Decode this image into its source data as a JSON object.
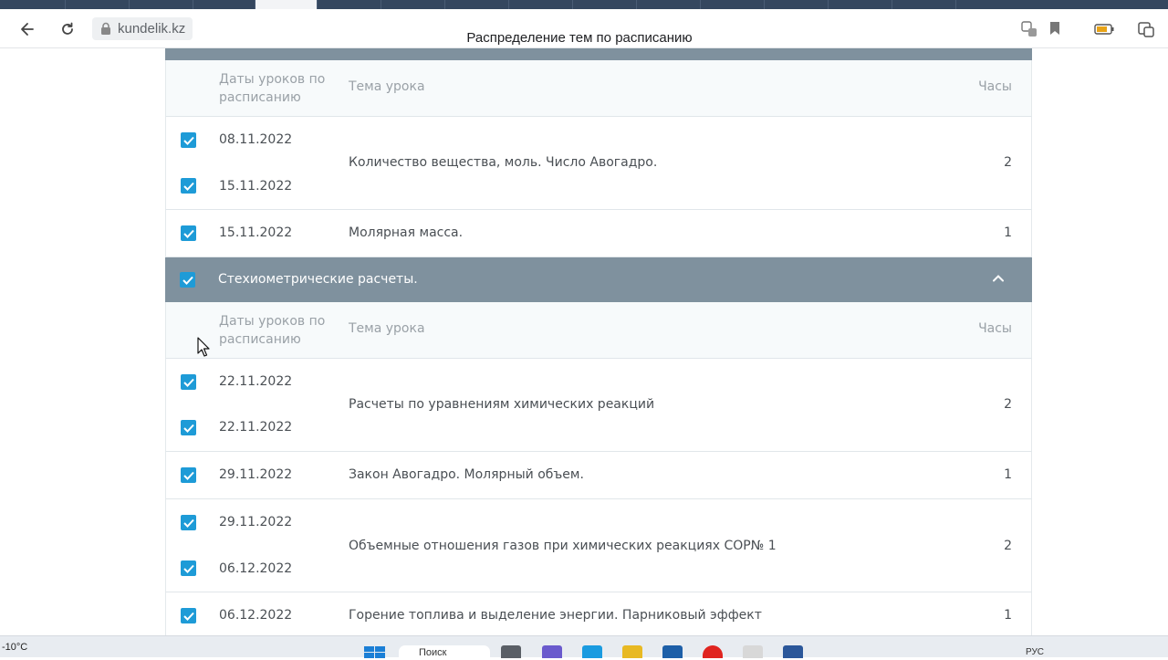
{
  "browser": {
    "url": "kundelik.kz",
    "page_title": "Распределение тем по расписанию"
  },
  "table": {
    "col_dates": "Даты уроков по расписанию",
    "col_topic": "Тема урока",
    "col_hours": "Часы"
  },
  "group1_rows": [
    {
      "dates": [
        "08.11.2022",
        "15.11.2022"
      ],
      "topic": "Количество вещества, моль. Число Авогадро.",
      "hours": "2"
    },
    {
      "dates": [
        "15.11.2022"
      ],
      "topic": "Молярная масса.",
      "hours": "1"
    }
  ],
  "section2": {
    "title": "Стехиометрические расчеты."
  },
  "group2_rows": [
    {
      "dates": [
        "22.11.2022",
        "22.11.2022"
      ],
      "topic": "Расчеты по уравнениям химических реакций",
      "hours": "2"
    },
    {
      "dates": [
        "29.11.2022"
      ],
      "topic": "Закон Авогадро. Молярный объем.",
      "hours": "1"
    },
    {
      "dates": [
        "29.11.2022",
        "06.12.2022"
      ],
      "topic": "Объемные отношения газов при химических реакциях СОР№ 1",
      "hours": "2"
    },
    {
      "dates": [
        "06.12.2022"
      ],
      "topic": "Горение топлива и выделение энергии. Парниковый эффект",
      "hours": "1"
    }
  ],
  "taskbar": {
    "weather": "-10°C",
    "search": "Поиск",
    "lang": "РУС"
  },
  "colors": {
    "section_bg": "#7f919e",
    "checkbox": "#1e9bd7",
    "header_bg": "#f7fafb"
  }
}
